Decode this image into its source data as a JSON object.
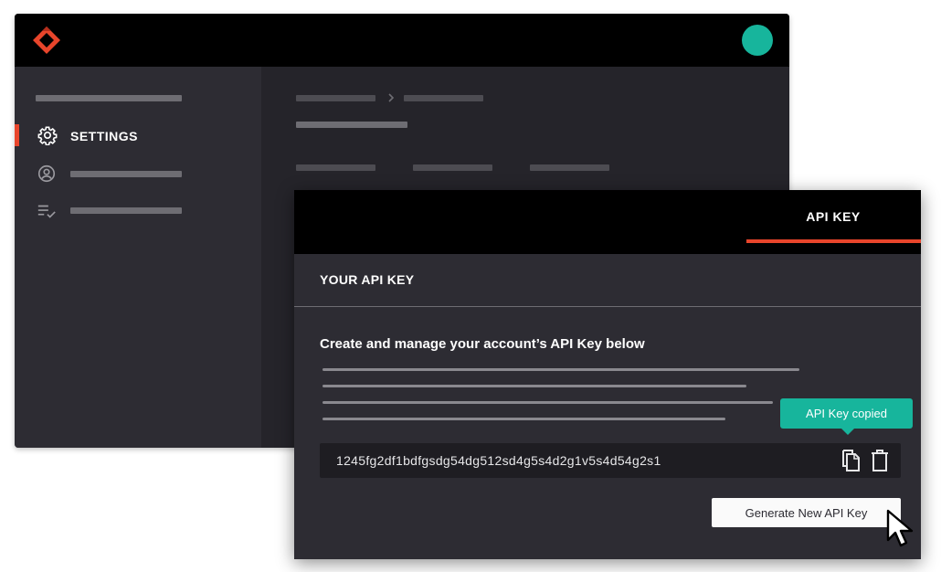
{
  "nav": {
    "settings_label": "SETTINGS"
  },
  "panel": {
    "tab_label": "API KEY",
    "section_title": "YOUR API KEY",
    "description": "Create and manage your account’s API Key below",
    "tooltip": "API Key copied",
    "api_key": "1245fg2df1bdfgsdg54dg512sd4g5s4d2g1v5s4d54g2s1",
    "generate_button": "Generate New API Key"
  },
  "colors": {
    "accent": "#e8452b",
    "teal": "#17b59c",
    "topbar": "#000000",
    "panel_bg": "#2d2c33"
  },
  "icons": [
    "logo-icon",
    "gear-icon",
    "user-circle-icon",
    "checklist-icon",
    "chevron-right-icon",
    "copy-icon",
    "trash-icon",
    "cursor-icon"
  ]
}
